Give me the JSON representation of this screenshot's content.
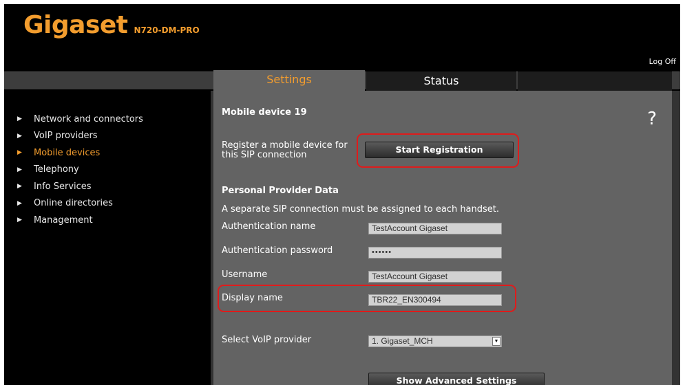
{
  "header": {
    "brand": "Gigaset",
    "model": "N720-DM-PRO",
    "logoff_label": "Log Off"
  },
  "tabs": [
    {
      "label": "Settings",
      "active": true
    },
    {
      "label": "Status",
      "active": false
    }
  ],
  "sidebar": {
    "items": [
      {
        "label": "Network and connectors",
        "active": false
      },
      {
        "label": "VoIP providers",
        "active": false
      },
      {
        "label": "Mobile devices",
        "active": true
      },
      {
        "label": "Telephony",
        "active": false
      },
      {
        "label": "Info Services",
        "active": false
      },
      {
        "label": "Online directories",
        "active": false
      },
      {
        "label": "Management",
        "active": false
      }
    ]
  },
  "main": {
    "title": "Mobile device 19",
    "help_label": "?",
    "register": {
      "text_line1": "Register a mobile device for",
      "text_line2": "this SIP connection",
      "button_label": "Start Registration"
    },
    "provider_section_title": "Personal Provider Data",
    "provider_note": "A separate SIP connection must be assigned to each handset.",
    "fields": {
      "auth_name": {
        "label": "Authentication name",
        "value": "TestAccount Gigaset"
      },
      "auth_password": {
        "label": "Authentication password",
        "value": "••••••"
      },
      "username": {
        "label": "Username",
        "value": "TestAccount Gigaset"
      },
      "display_name": {
        "label": "Display name",
        "value": "TBR22_EN300494"
      }
    },
    "voip_provider": {
      "label": "Select VoIP provider",
      "selected": "1. Gigaset_MCH"
    },
    "advanced_button_label": "Show Advanced Settings"
  },
  "colors": {
    "accent": "#f39d2e",
    "highlight": "#e01b1b",
    "panel": "#636363"
  }
}
